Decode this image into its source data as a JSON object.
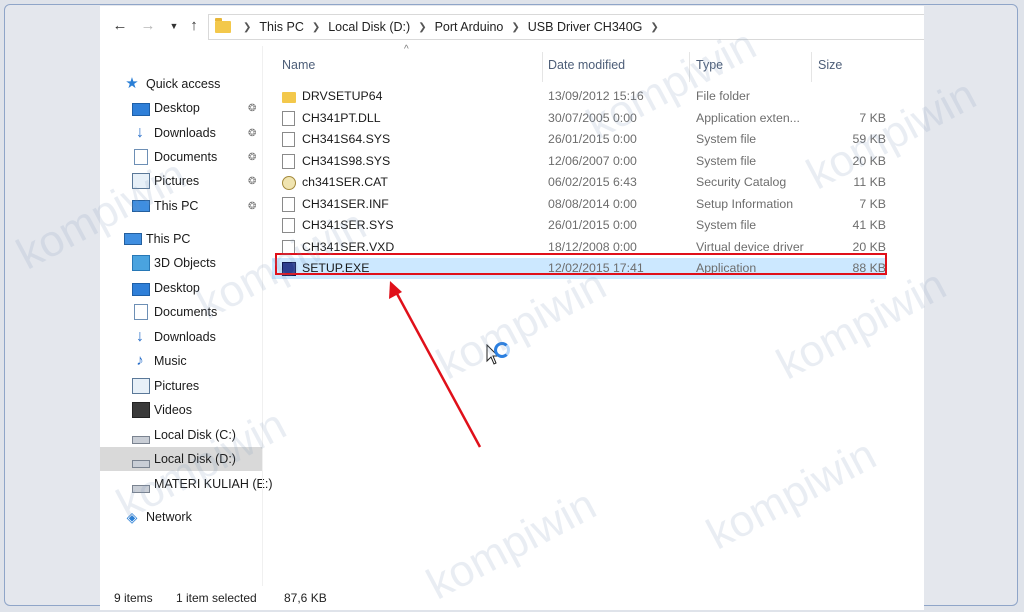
{
  "window": {
    "breadcrumb": [
      "This PC",
      "Local Disk (D:)",
      "Port Arduino",
      "USB Driver CH340G"
    ]
  },
  "sidebar": {
    "items": [
      {
        "label": "Quick access",
        "icon": "star-icon",
        "pinned": false
      },
      {
        "label": "Desktop",
        "icon": "desktop-icon",
        "pinned": true
      },
      {
        "label": "Downloads",
        "icon": "download-icon",
        "pinned": true
      },
      {
        "label": "Documents",
        "icon": "documents-icon",
        "pinned": true
      },
      {
        "label": "Pictures",
        "icon": "pictures-icon",
        "pinned": true
      },
      {
        "label": "This PC",
        "icon": "computer-icon",
        "pinned": true
      },
      {
        "label": "This PC",
        "icon": "computer-icon",
        "pinned": false
      },
      {
        "label": "3D Objects",
        "icon": "3d-objects-icon",
        "pinned": false
      },
      {
        "label": "Desktop",
        "icon": "desktop-icon",
        "pinned": false
      },
      {
        "label": "Documents",
        "icon": "documents-icon",
        "pinned": false
      },
      {
        "label": "Downloads",
        "icon": "download-icon",
        "pinned": false
      },
      {
        "label": "Music",
        "icon": "music-icon",
        "pinned": false
      },
      {
        "label": "Pictures",
        "icon": "pictures-icon",
        "pinned": false
      },
      {
        "label": "Videos",
        "icon": "videos-icon",
        "pinned": false
      },
      {
        "label": "Local Disk (C:)",
        "icon": "drive-icon",
        "pinned": false
      },
      {
        "label": "Local Disk (D:)",
        "icon": "drive-icon",
        "pinned": false,
        "selected": true
      },
      {
        "label": "MATERI KULIAH (E:)",
        "icon": "drive-icon",
        "pinned": false
      },
      {
        "label": "Network",
        "icon": "network-icon",
        "pinned": false
      }
    ]
  },
  "columns": {
    "name": "Name",
    "date": "Date modified",
    "type": "Type",
    "size": "Size"
  },
  "files": [
    {
      "name": "DRVSETUP64",
      "date": "13/09/2012 15:16",
      "type": "File folder",
      "size": "",
      "icon": "folder-icon"
    },
    {
      "name": "CH341PT.DLL",
      "date": "30/07/2005 0:00",
      "type": "Application exten...",
      "size": "7 KB",
      "icon": "file-icon"
    },
    {
      "name": "CH341S64.SYS",
      "date": "26/01/2015 0:00",
      "type": "System file",
      "size": "59 KB",
      "icon": "file-icon"
    },
    {
      "name": "CH341S98.SYS",
      "date": "12/06/2007 0:00",
      "type": "System file",
      "size": "20 KB",
      "icon": "file-icon"
    },
    {
      "name": "ch341SER.CAT",
      "date": "06/02/2015 6:43",
      "type": "Security Catalog",
      "size": "11 KB",
      "icon": "catalog-icon"
    },
    {
      "name": "CH341SER.INF",
      "date": "08/08/2014 0:00",
      "type": "Setup Information",
      "size": "7 KB",
      "icon": "file-icon"
    },
    {
      "name": "CH341SER.SYS",
      "date": "26/01/2015 0:00",
      "type": "System file",
      "size": "41 KB",
      "icon": "file-icon"
    },
    {
      "name": "CH341SER.VXD",
      "date": "18/12/2008 0:00",
      "type": "Virtual device driver",
      "size": "20 KB",
      "icon": "file-icon"
    },
    {
      "name": "SETUP.EXE",
      "date": "12/02/2015 17:41",
      "type": "Application",
      "size": "88 KB",
      "icon": "exe-icon",
      "selected": true
    }
  ],
  "status": {
    "count": "9 items",
    "selection": "1 item selected",
    "size": "87,6 KB"
  },
  "watermark": "kompiwin",
  "colors": {
    "highlight": "#e0101a",
    "selection": "#cce8ff",
    "sidebar_selection": "#d9d9d9"
  }
}
